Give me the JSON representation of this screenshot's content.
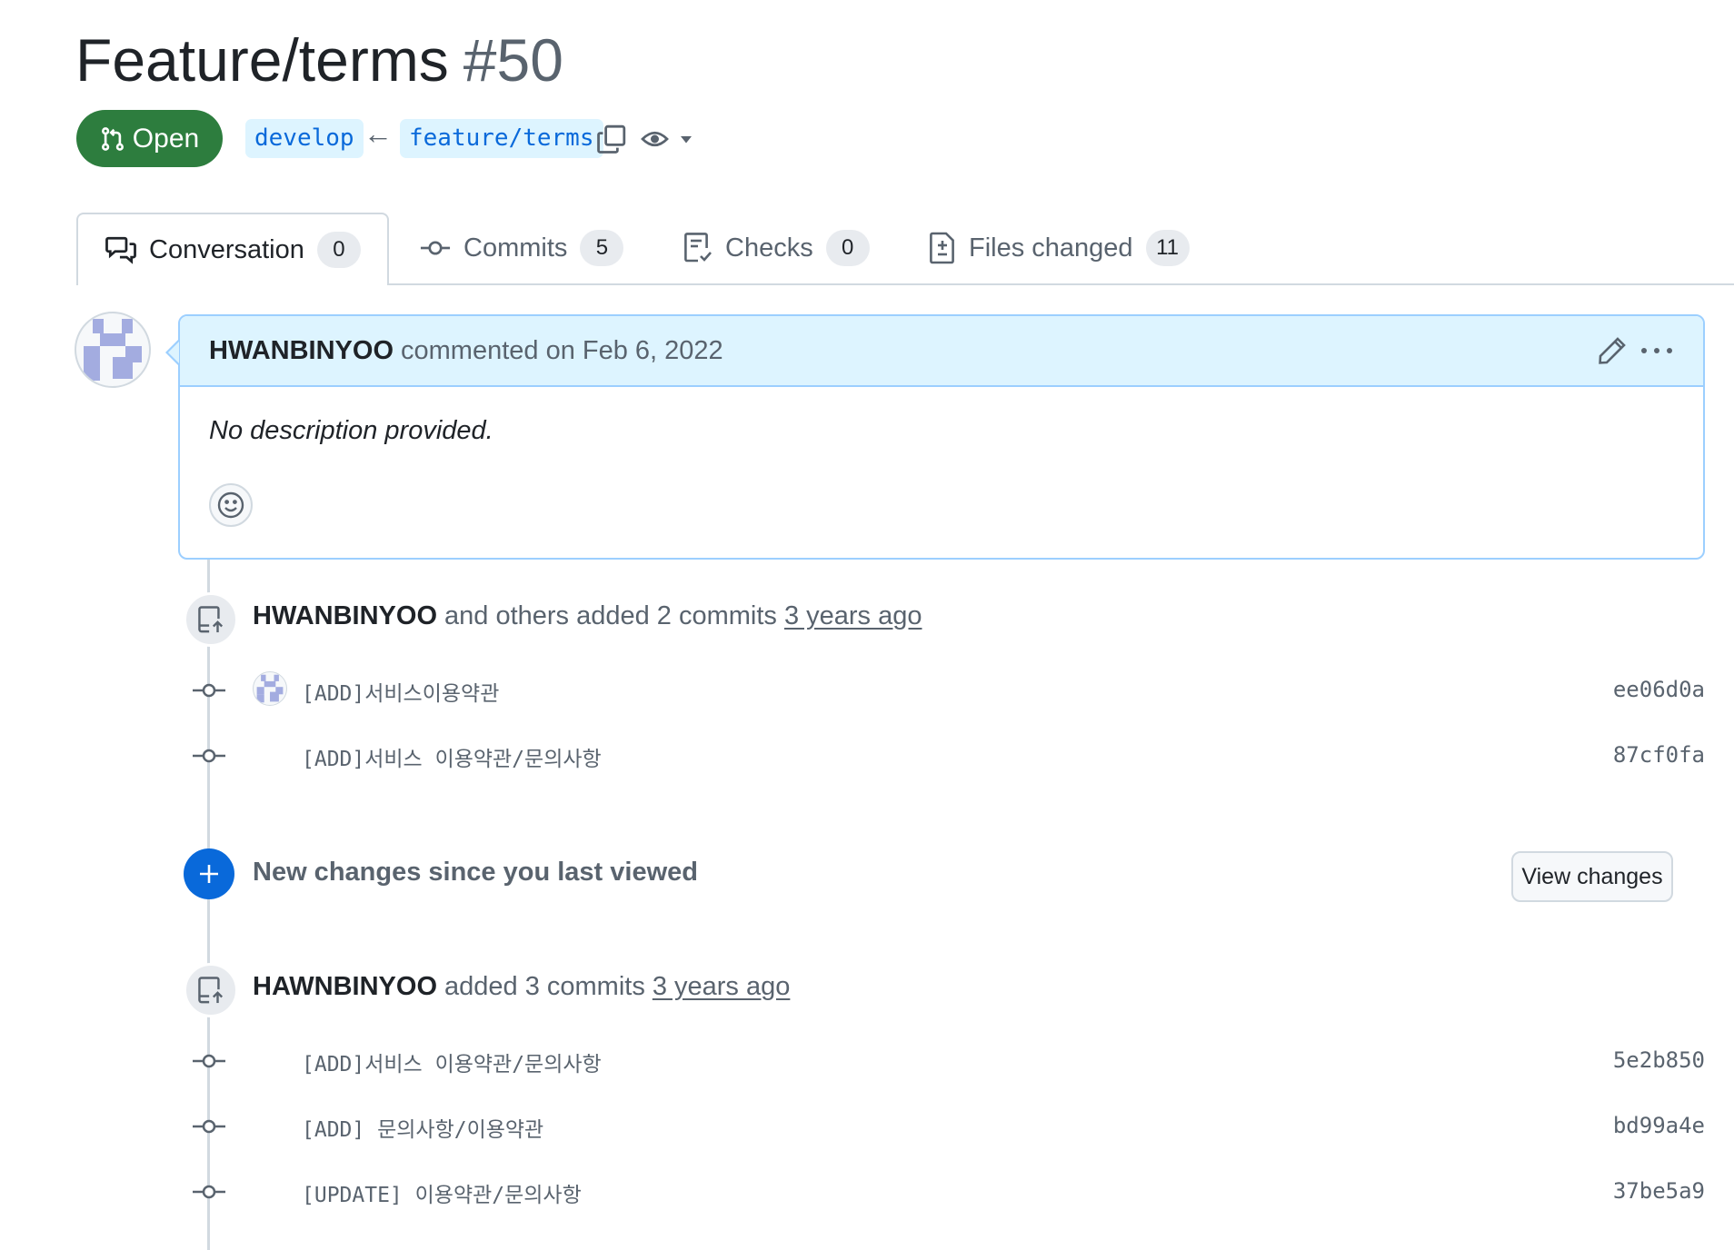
{
  "pr": {
    "title": "Feature/terms",
    "number": "#50",
    "state": "Open",
    "base_branch": "develop",
    "arrow": "←",
    "head_branch": "feature/terms"
  },
  "tabs": [
    {
      "label": "Conversation",
      "count": "0",
      "icon": "comment-discussion-icon",
      "active": true
    },
    {
      "label": "Commits",
      "count": "5",
      "icon": "git-commit-icon"
    },
    {
      "label": "Checks",
      "count": "0",
      "icon": "checklist-icon"
    },
    {
      "label": "Files changed",
      "count": "11",
      "icon": "file-diff-icon"
    }
  ],
  "comment": {
    "author": "HWANBINYOO",
    "meta": "commented on Feb 6, 2022",
    "body": "No description provided."
  },
  "timeline": [
    {
      "author": "HWANBINYOO",
      "action": "and others added 2 commits",
      "time": "3 years ago",
      "commits": [
        {
          "message": "[ADD]서비스이용약관",
          "sha": "ee06d0a"
        },
        {
          "message": "[ADD]서비스 이용약관/문의사항",
          "sha": "87cf0fa"
        }
      ]
    },
    {
      "author": "HAWNBINYOO",
      "action": "added 3 commits",
      "time": "3 years ago",
      "commits": [
        {
          "message": "[ADD]서비스 이용약관/문의사항",
          "sha": "5e2b850"
        },
        {
          "message": "[ADD] 문의사항/이용약관",
          "sha": "bd99a4e"
        },
        {
          "message": "[UPDATE] 이용약관/문의사항",
          "sha": "37be5a9"
        }
      ]
    }
  ],
  "new_changes": {
    "text": "New changes since you last viewed",
    "button": "View changes"
  },
  "colors": {
    "open_green": "#2d7d3e",
    "accent_blue": "#0969da",
    "comment_header": "#ddf4ff",
    "comment_border": "#9ccfff"
  }
}
